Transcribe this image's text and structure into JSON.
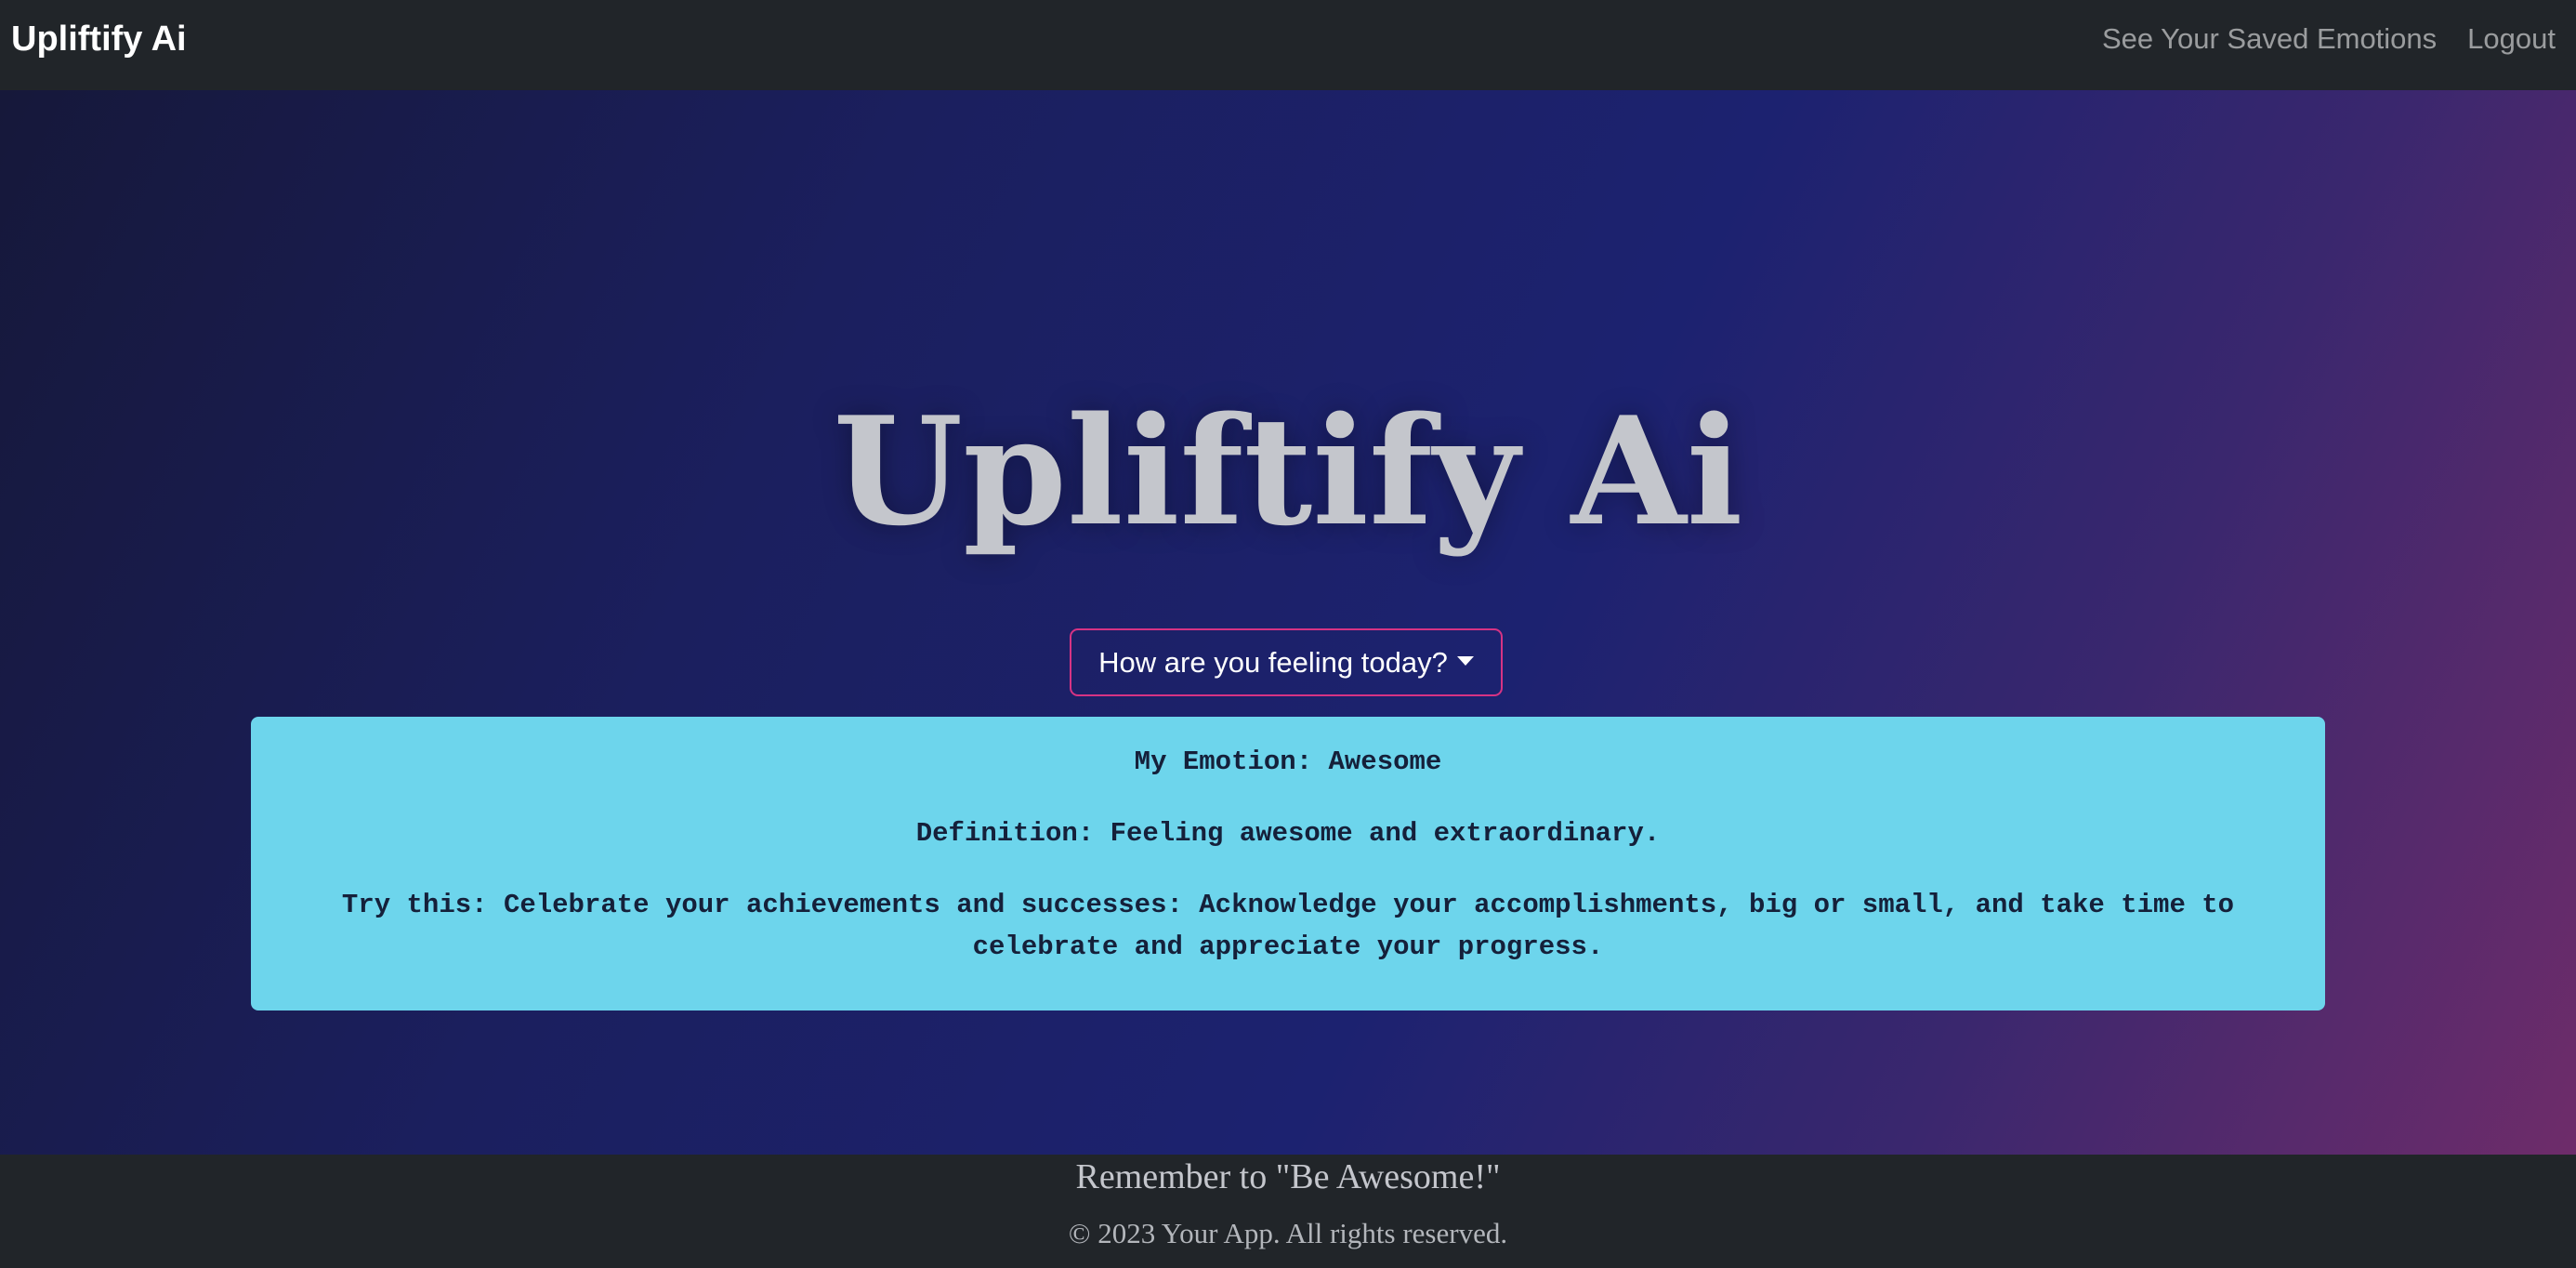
{
  "navbar": {
    "brand": "Upliftify Ai",
    "links": [
      {
        "label": "See Your Saved Emotions"
      },
      {
        "label": "Logout"
      }
    ]
  },
  "hero": {
    "title": "Upliftify Ai",
    "dropdown_label": "How are you feeling today?"
  },
  "emotion_card": {
    "emotion_line": "My Emotion: Awesome",
    "definition_line": "Definition: Feeling awesome and extraordinary.",
    "suggestion_line": "Try this: Celebrate your achievements and successes: Acknowledge your accomplishments, big or small, and take time to celebrate and appreciate your progress."
  },
  "footer": {
    "tagline": "Remember to \"Be Awesome!\"",
    "copyright": "© 2023 Your App. All rights reserved."
  },
  "colors": {
    "navbar_bg": "#212529",
    "card_bg": "#6dd5ec",
    "dropdown_border": "#d63384",
    "gradient_start": "#16183a",
    "gradient_mid": "#1c2270",
    "gradient_end": "#6e2c6a"
  },
  "icons": {
    "dropdown": "caret-down-icon"
  }
}
